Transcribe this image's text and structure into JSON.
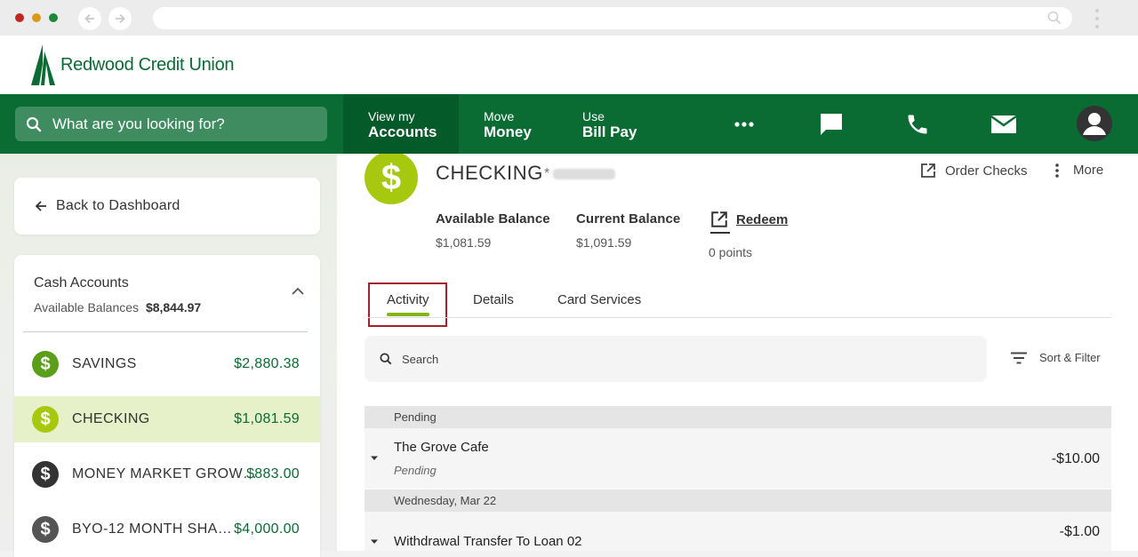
{
  "browser": {
    "icons": [
      "back-arrow-icon",
      "forward-arrow-icon",
      "search-icon",
      "kebab-icon"
    ]
  },
  "brand": {
    "name": "Redwood Credit Union",
    "color": "#0a6b33"
  },
  "topnav": {
    "search_placeholder": "What are you looking for?",
    "items": [
      {
        "line1": "View my",
        "line2": "Accounts",
        "active": true
      },
      {
        "line1": "Move",
        "line2": "Money",
        "active": false
      },
      {
        "line1": "Use",
        "line2": "Bill Pay",
        "active": false
      }
    ],
    "icons": [
      "more-dots-icon",
      "chat-icon",
      "phone-icon",
      "mail-icon",
      "user-avatar-icon"
    ]
  },
  "sidebar": {
    "back_label": "Back to Dashboard",
    "section_title": "Cash Accounts",
    "available_label": "Available Balances",
    "available_total": "$8,844.97",
    "accounts": [
      {
        "name": "SAVINGS",
        "balance": "$2,880.38",
        "icon_color": "#5a9e1a",
        "selected": false
      },
      {
        "name": "CHECKING",
        "balance": "$1,081.59",
        "icon_color": "#a6c90f",
        "selected": true
      },
      {
        "name": "MONEY MARKET GROW…",
        "balance": "$883.00",
        "icon_color": "#333333",
        "selected": false
      },
      {
        "name": "BYO-12 MONTH SHA…",
        "balance": "$4,000.00",
        "icon_color": "#555555",
        "selected": false
      }
    ]
  },
  "account": {
    "title": "CHECKING",
    "masked_number": "*",
    "order_checks": "Order Checks",
    "more": "More",
    "available_label": "Available Balance",
    "available_value": "$1,081.59",
    "current_label": "Current Balance",
    "current_value": "$1,091.59",
    "redeem_label": "Redeem",
    "points": "0 points"
  },
  "tabs": [
    "Activity",
    "Details",
    "Card Services"
  ],
  "activity": {
    "search_placeholder": "Search",
    "sort_filter": "Sort & Filter",
    "groups": [
      {
        "header": "Pending",
        "transactions": [
          {
            "name": "The Grove Cafe",
            "status": "Pending",
            "amount": "-$10.00"
          }
        ]
      },
      {
        "header": "Wednesday, Mar 22",
        "transactions": [
          {
            "name": "Withdrawal Transfer To Loan 02",
            "status": "",
            "amount": "-$1.00"
          }
        ]
      }
    ]
  },
  "colors": {
    "highlight_box": "#a3232b",
    "tab_accent": "#82b514",
    "selected_row": "#e6f0c9"
  }
}
